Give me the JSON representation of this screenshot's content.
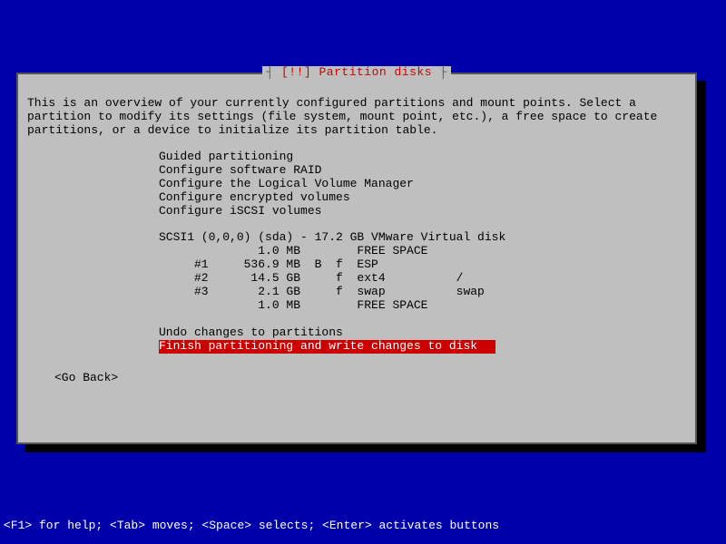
{
  "title": {
    "bracket_open": "┤ ",
    "bang": "[!!] ",
    "text": "Partition disks",
    "bracket_close": " ├"
  },
  "intro": "This is an overview of your currently configured partitions and mount points. Select a partition to modify its settings (file system, mount point, etc.), a free space to create partitions, or a device to initialize its partition table.",
  "menu": {
    "guided": "Guided partitioning",
    "raid": "Configure software RAID",
    "lvm": "Configure the Logical Volume Manager",
    "encrypted": "Configure encrypted volumes",
    "iscsi": "Configure iSCSI volumes",
    "disk_header": "SCSI1 (0,0,0) (sda) - 17.2 GB VMware Virtual disk",
    "p_free1": "              1.0 MB        FREE SPACE",
    "p1": "     #1     536.9 MB  B  f  ESP",
    "p2": "     #2      14.5 GB     f  ext4          /",
    "p3": "     #3       2.1 GB     f  swap          swap",
    "p_free2": "              1.0 MB        FREE SPACE",
    "undo": "Undo changes to partitions",
    "finish": "Finish partitioning and write changes to disk"
  },
  "go_back": "<Go Back>",
  "help_bar": "<F1> for help; <Tab> moves; <Space> selects; <Enter> activates buttons"
}
